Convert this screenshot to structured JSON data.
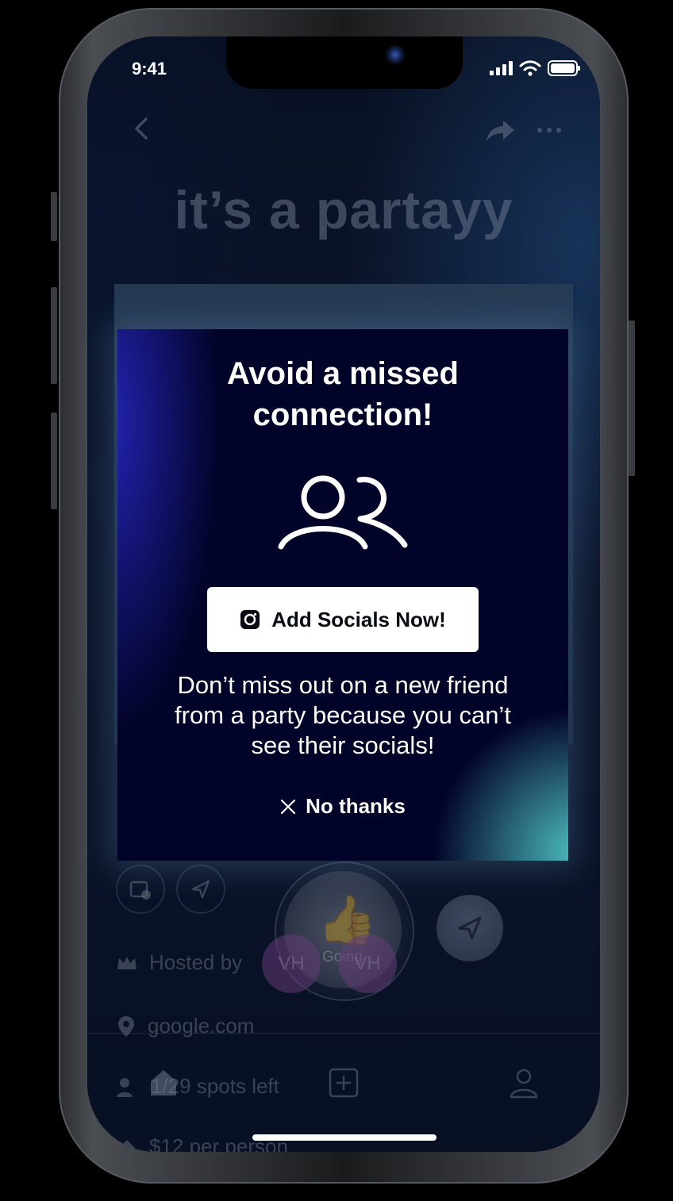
{
  "status_bar": {
    "time": "9:41"
  },
  "event": {
    "title": "it’s a partayy",
    "going_label": "Going",
    "avatar_1": "VH",
    "avatar_2": "VH",
    "hosted_by": "Hosted by",
    "location": "google.com",
    "spots": "1/29 spots left",
    "price": "$12 per person"
  },
  "modal": {
    "title_line1": "Avoid a missed",
    "title_line2": "connection!",
    "cta_label": "Add Socials Now!",
    "body_line1": "Don’t miss out on a new friend",
    "body_line2": "from a party because you can’t",
    "body_line3": "see their socials!",
    "dismiss_label": "No thanks"
  },
  "colors": {
    "modal_bg": "#020328",
    "modal_glow_teal": "#50c8c8",
    "modal_glow_blue": "#2828c8",
    "cta_bg": "#ffffff"
  },
  "icons": [
    "back-icon",
    "share-icon",
    "more-icon",
    "people-icon",
    "instagram-icon",
    "close-icon",
    "calendar-add-icon",
    "send-icon",
    "crown-icon",
    "pin-icon",
    "users-icon",
    "ticket-icon",
    "home-icon",
    "add-icon",
    "profile-icon"
  ]
}
